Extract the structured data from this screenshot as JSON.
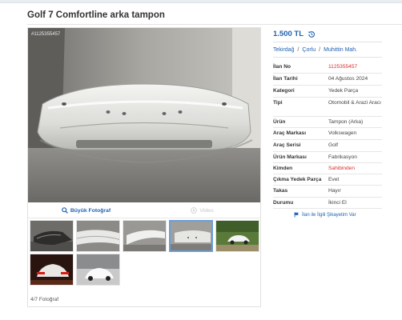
{
  "page_title": "Golf 7 Comfortline arka tampon",
  "gallery": {
    "photo_id": "#1125355457",
    "big_photo_label": "Büyük Fotoğraf",
    "video_label": "Video",
    "photo_counter": "4/7 Fotoğraf",
    "thumbnails": [
      {
        "name": "thumb-1",
        "subject": "bumper-on-floor"
      },
      {
        "name": "thumb-2",
        "subject": "bumper-closeup"
      },
      {
        "name": "thumb-3",
        "subject": "bumper-side"
      },
      {
        "name": "thumb-4",
        "subject": "bumper-wrapped",
        "active": true
      },
      {
        "name": "thumb-5",
        "subject": "white-car-outdoor"
      },
      {
        "name": "thumb-6",
        "subject": "car-in-garage"
      },
      {
        "name": "thumb-7",
        "subject": "white-golf-parked"
      }
    ]
  },
  "listing": {
    "price": "1.500 TL",
    "location": {
      "city": "Tekirdağ",
      "district": "Çorlu",
      "neighborhood": "Muhittin Mah.",
      "separator": "/"
    },
    "details": [
      {
        "label": "İlan No",
        "value": "1125355457",
        "highlight": true
      },
      {
        "label": "İlan Tarihi",
        "value": "04 Ağustos 2024"
      },
      {
        "label": "Kategori",
        "value": "Yedek Parça"
      },
      {
        "label": "Tipi",
        "value": "Otomobil & Arazi Aracı"
      },
      {
        "label": "Ürün",
        "value": "Tampon (Arka)"
      },
      {
        "label": "Araç Markası",
        "value": "Volkswagen"
      },
      {
        "label": "Araç Serisi",
        "value": "Golf"
      },
      {
        "label": "Ürün Markası",
        "value": "Fabrikasyon"
      },
      {
        "label": "Kimden",
        "value": "Sahibinden",
        "highlight": true
      },
      {
        "label": "Çıkma Yedek Parça",
        "value": "Evet"
      },
      {
        "label": "Takas",
        "value": "Hayır"
      },
      {
        "label": "Durumu",
        "value": "İkinci El"
      }
    ],
    "complaint_label": "İlan ile İlgili Şikayetim Var"
  },
  "colors": {
    "link": "#1f62b2",
    "highlight": "#d6312c",
    "active_thumb_border": "#6a9ed8"
  }
}
